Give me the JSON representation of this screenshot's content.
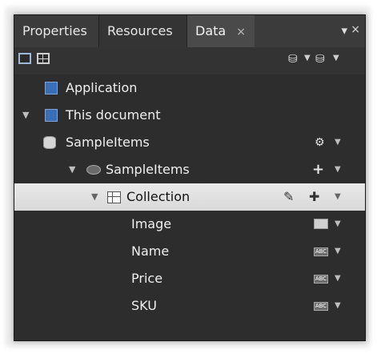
{
  "tabs": [
    {
      "label": "Properties"
    },
    {
      "label": "Resources"
    },
    {
      "label": "Data",
      "close": "×"
    }
  ],
  "window_controls": {
    "pin": "▼",
    "close": "×"
  },
  "toolbar": {
    "view_list_icon": "list-view-icon",
    "view_details_icon": "details-view-icon",
    "create_sample_data_icon": "create-sample-data-icon",
    "create_data_source_icon": "create-data-source-icon"
  },
  "tree": {
    "application": {
      "label": "Application"
    },
    "this_document": {
      "label": "This document",
      "expander": "▼"
    },
    "sample_items_source": {
      "label": "SampleItems"
    },
    "sample_items_object": {
      "label": "SampleItems",
      "expander": "▼",
      "add": "+"
    },
    "collection": {
      "label": "Collection",
      "expander": "▼"
    },
    "fields": [
      {
        "label": "Image",
        "type_icon": "image-type-icon"
      },
      {
        "label": "Name",
        "type_icon": "string-type-icon",
        "badge": "ABC"
      },
      {
        "label": "Price",
        "type_icon": "string-type-icon",
        "badge": "ABC"
      },
      {
        "label": "SKU",
        "type_icon": "string-type-icon",
        "badge": "ABC"
      }
    ]
  },
  "colors": {
    "panel_bg": "#2d2d2d",
    "tabstrip_bg": "#3b3b3b",
    "selected_row": "#e0e0e0",
    "text": "#f0f0f0"
  }
}
